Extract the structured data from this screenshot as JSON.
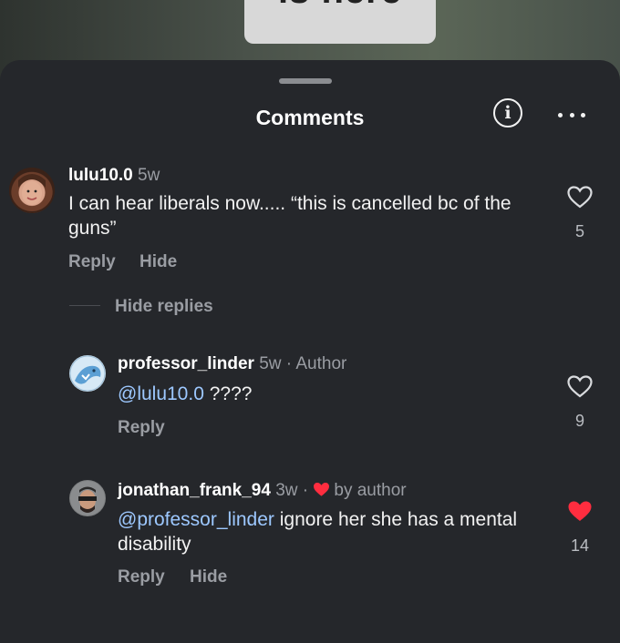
{
  "backdrop": {
    "partial_text": "is here"
  },
  "sheet": {
    "title": "Comments"
  },
  "comments": [
    {
      "username": "lulu10.0",
      "age": "5w",
      "text": "I can hear liberals now..... “this is cancelled bc of the guns”",
      "actions": {
        "reply": "Reply",
        "hide": "Hide"
      },
      "likes": "5",
      "liked": false
    }
  ],
  "hide_replies_label": "Hide replies",
  "replies": [
    {
      "username": "professor_linder",
      "age": "5w",
      "tag": "· Author",
      "mention": "@lulu10.0",
      "text": " ????",
      "actions": {
        "reply": "Reply"
      },
      "likes": "9",
      "liked": false
    },
    {
      "username": "jonathan_frank_94",
      "age": "3w",
      "separator": "·",
      "badge": "by author",
      "mention": "@professor_linder",
      "text": " ignore her she has a mental disability",
      "actions": {
        "reply": "Reply",
        "hide": "Hide"
      },
      "likes": "14",
      "liked": true
    }
  ],
  "colors": {
    "sheet_bg": "#25272b",
    "mention": "#9dc8ff",
    "liked_heart": "#ff2d3f",
    "muted": "#9a9da3"
  },
  "icons": [
    "info-icon",
    "more-options-icon",
    "heart-outline-icon",
    "heart-filled-icon"
  ]
}
